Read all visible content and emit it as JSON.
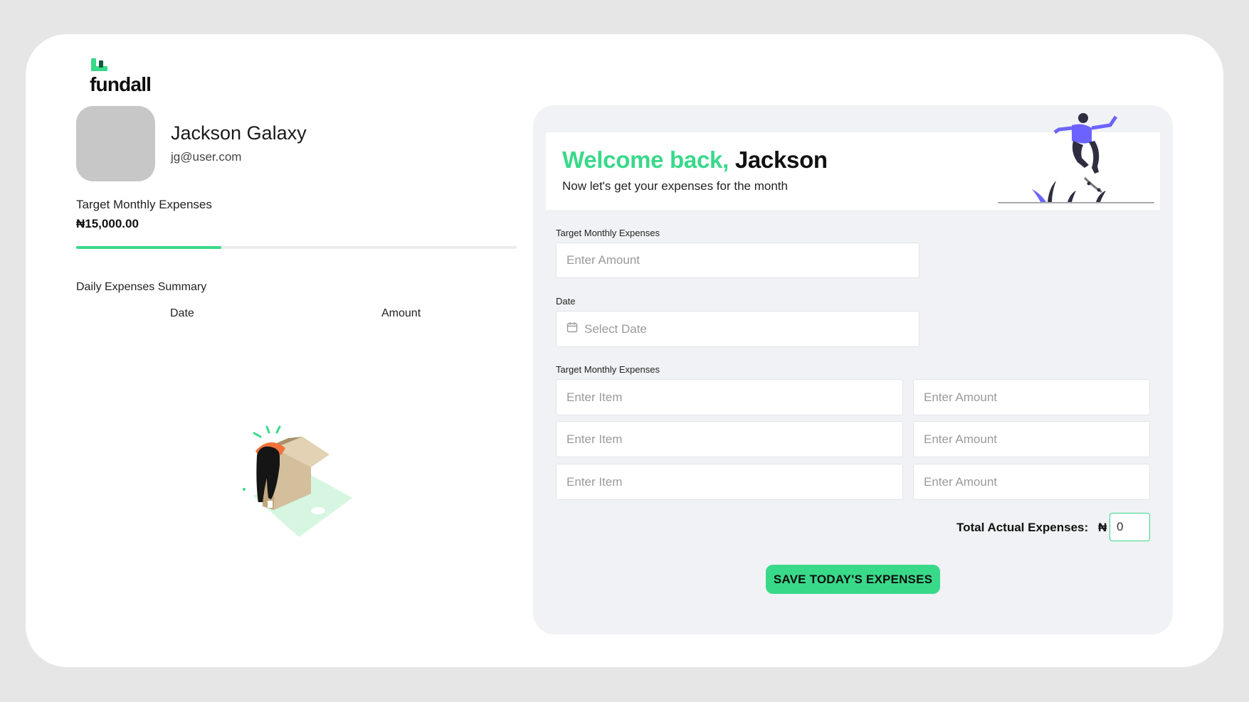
{
  "brand": {
    "name": "fundall",
    "accent": "#39d98a",
    "dark_accent": "#0f5b3c"
  },
  "profile": {
    "name": "Jackson Galaxy",
    "email": "jg@user.com"
  },
  "target": {
    "label": "Target Monthly Expenses",
    "value": "₦15,000.00",
    "progress_fraction": 0.33
  },
  "summary": {
    "title": "Daily Expenses Summary",
    "columns": [
      "Date",
      "Amount"
    ]
  },
  "welcome": {
    "greeting": "Welcome back,",
    "name": "Jackson",
    "subtitle": "Now let's get your expenses for the month"
  },
  "form": {
    "target_label": "Target Monthly Expenses",
    "target_placeholder": "Enter Amount",
    "date_label": "Date",
    "date_placeholder": "Select Date",
    "items_label": "Target Monthly Expenses",
    "item_placeholder": "Enter Item",
    "amount_placeholder": "Enter Amount",
    "total_label": "Total Actual Expenses:",
    "currency": "₦",
    "total_value": "0",
    "save_label": "SAVE TODAY'S EXPENSES"
  }
}
